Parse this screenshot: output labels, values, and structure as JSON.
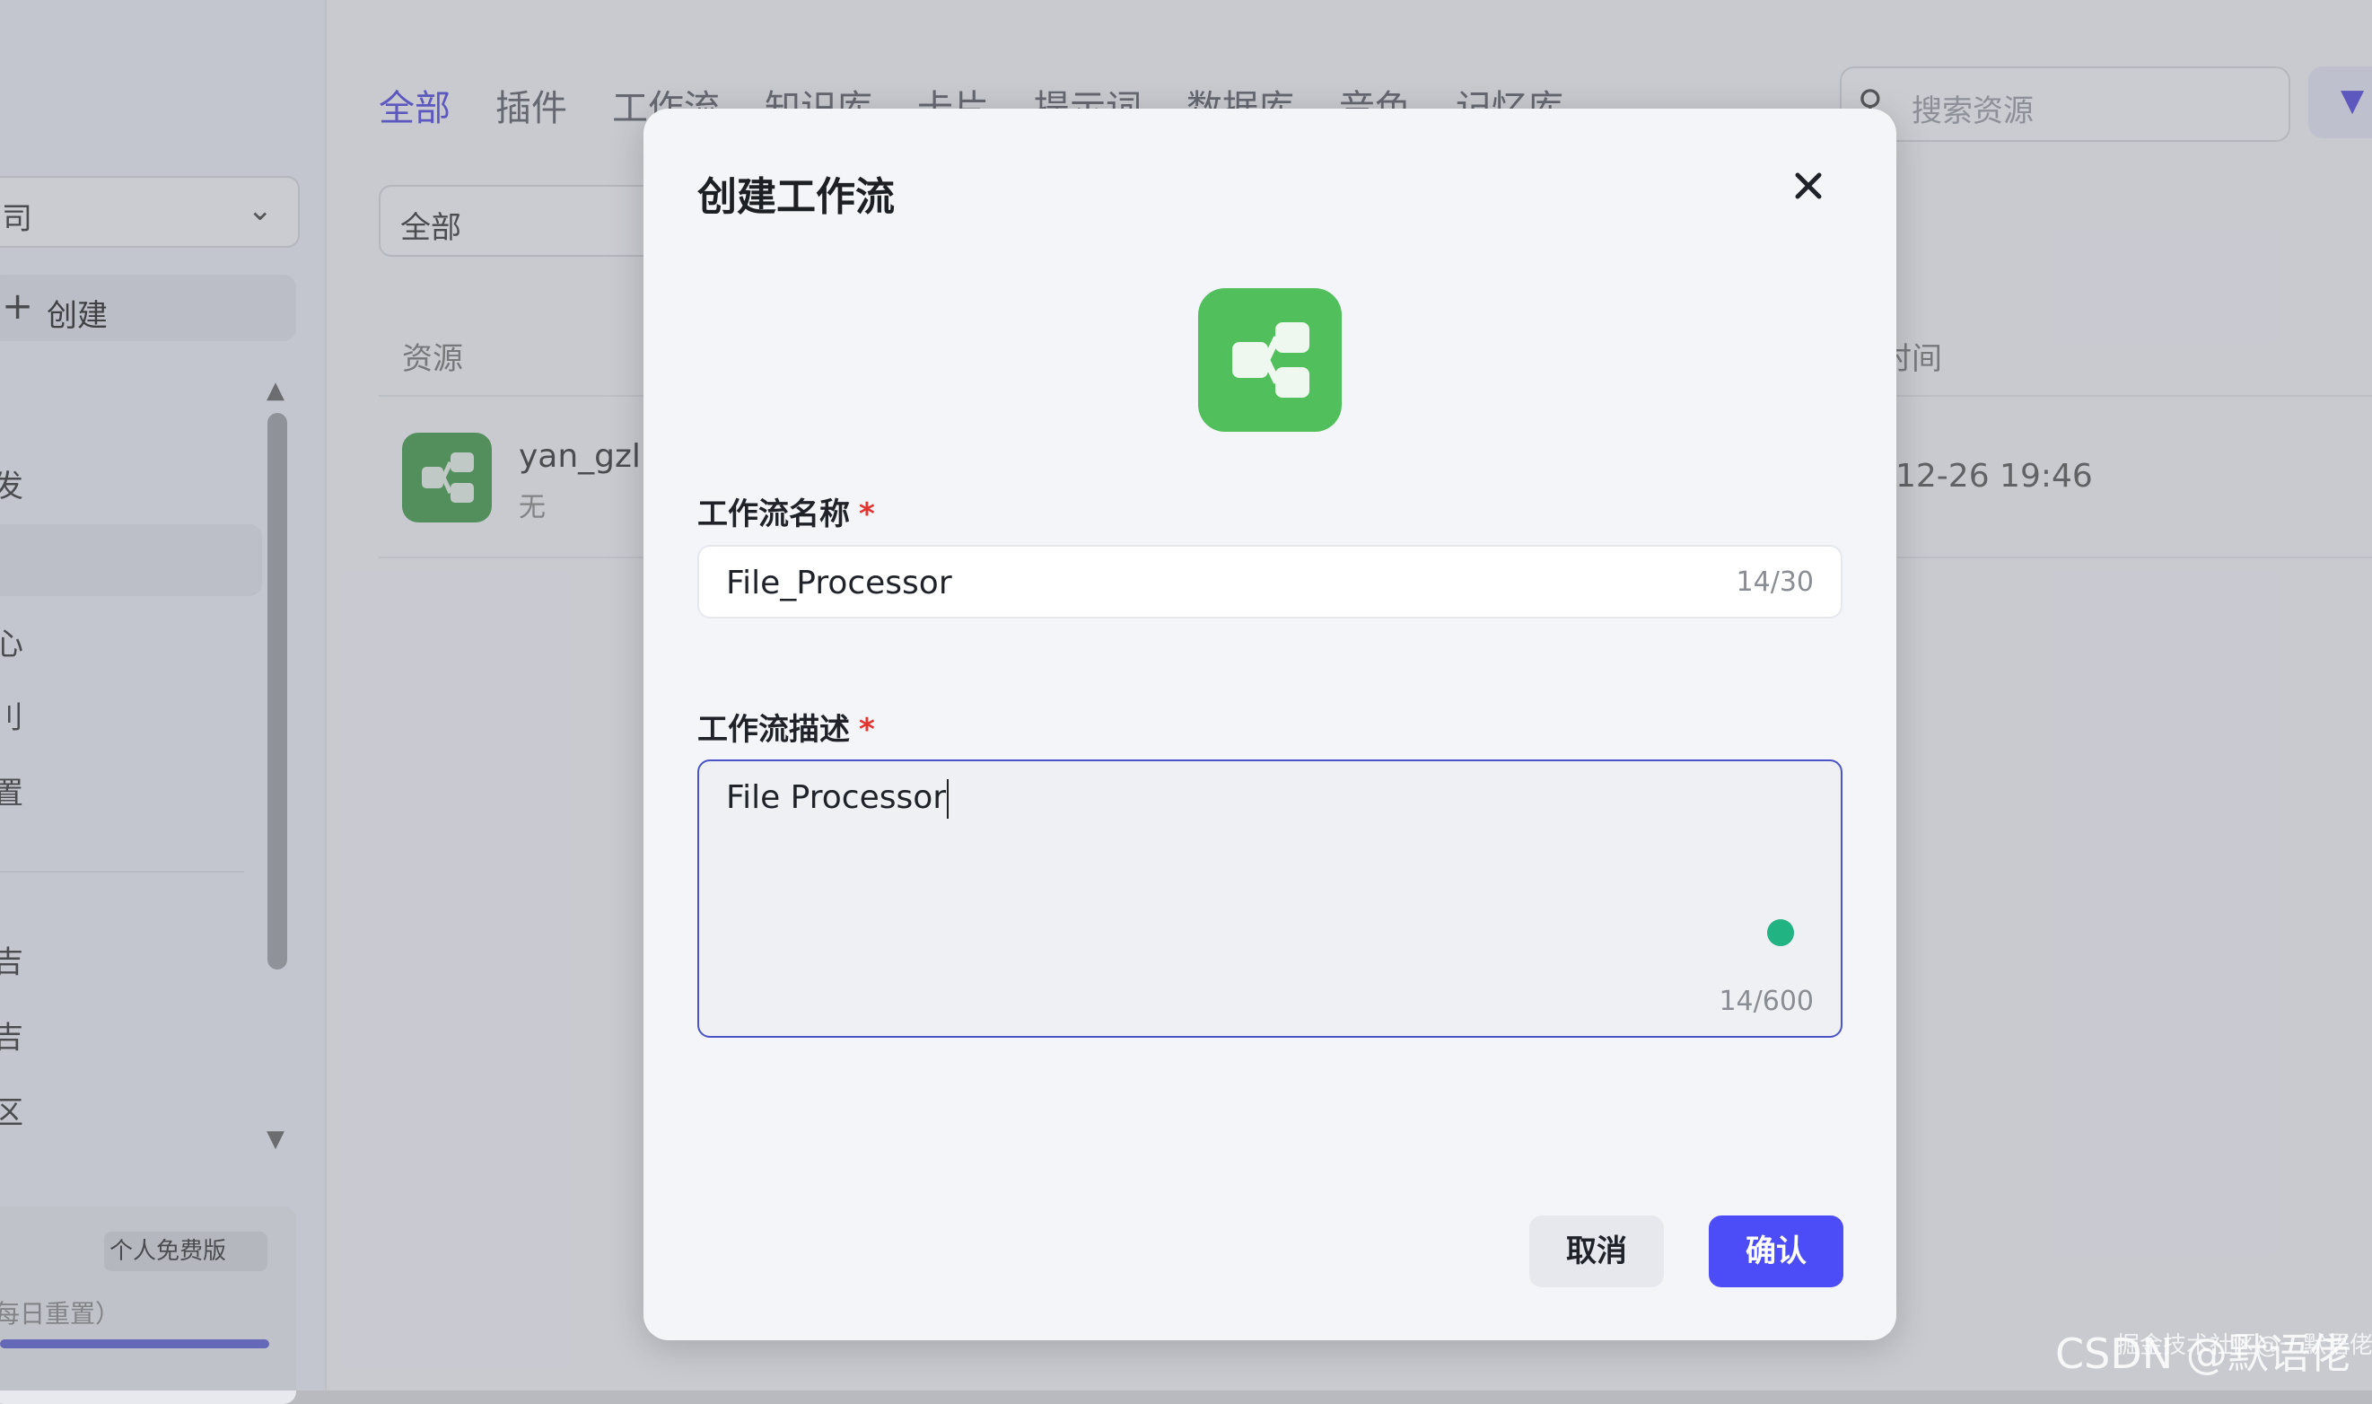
{
  "sidebar": {
    "workspace_select": "司",
    "create_label": "创建",
    "items": [
      "发",
      "心",
      "刂",
      "置",
      "吉",
      "吉",
      "区"
    ],
    "plan_badge": "个人免费版",
    "plan_text": "每日重置）"
  },
  "tabs": [
    "全部",
    "插件",
    "工作流",
    "知识库",
    "卡片",
    "提示词",
    "数据库",
    "音色",
    "记忆库"
  ],
  "search": {
    "placeholder": "搜索资源"
  },
  "filter": {
    "value": "全部"
  },
  "table": {
    "col_resource": "资源",
    "col_time": "时间",
    "rows": [
      {
        "name": "yan_gzl",
        "desc": "无",
        "time": "12-26 19:46"
      }
    ]
  },
  "modal": {
    "title": "创建工作流",
    "name_label": "工作流名称",
    "name_value": "File_Processor",
    "name_count": "14/30",
    "desc_label": "工作流描述",
    "desc_value": "File Processor",
    "desc_count": "14/600",
    "required_mark": "*",
    "cancel_label": "取消",
    "confirm_label": "确认"
  },
  "icons": {
    "close": "close-icon",
    "workflow": "workflow-icon",
    "search": "search-icon"
  },
  "colors": {
    "accent": "#4d4df7",
    "workflow_green": "#52bf5d",
    "required_red": "#e3342f",
    "focus_border": "#4a54c6"
  },
  "watermark": "CSDN @默语佬",
  "watermark_small": "掘金技术社区@一默语佬"
}
